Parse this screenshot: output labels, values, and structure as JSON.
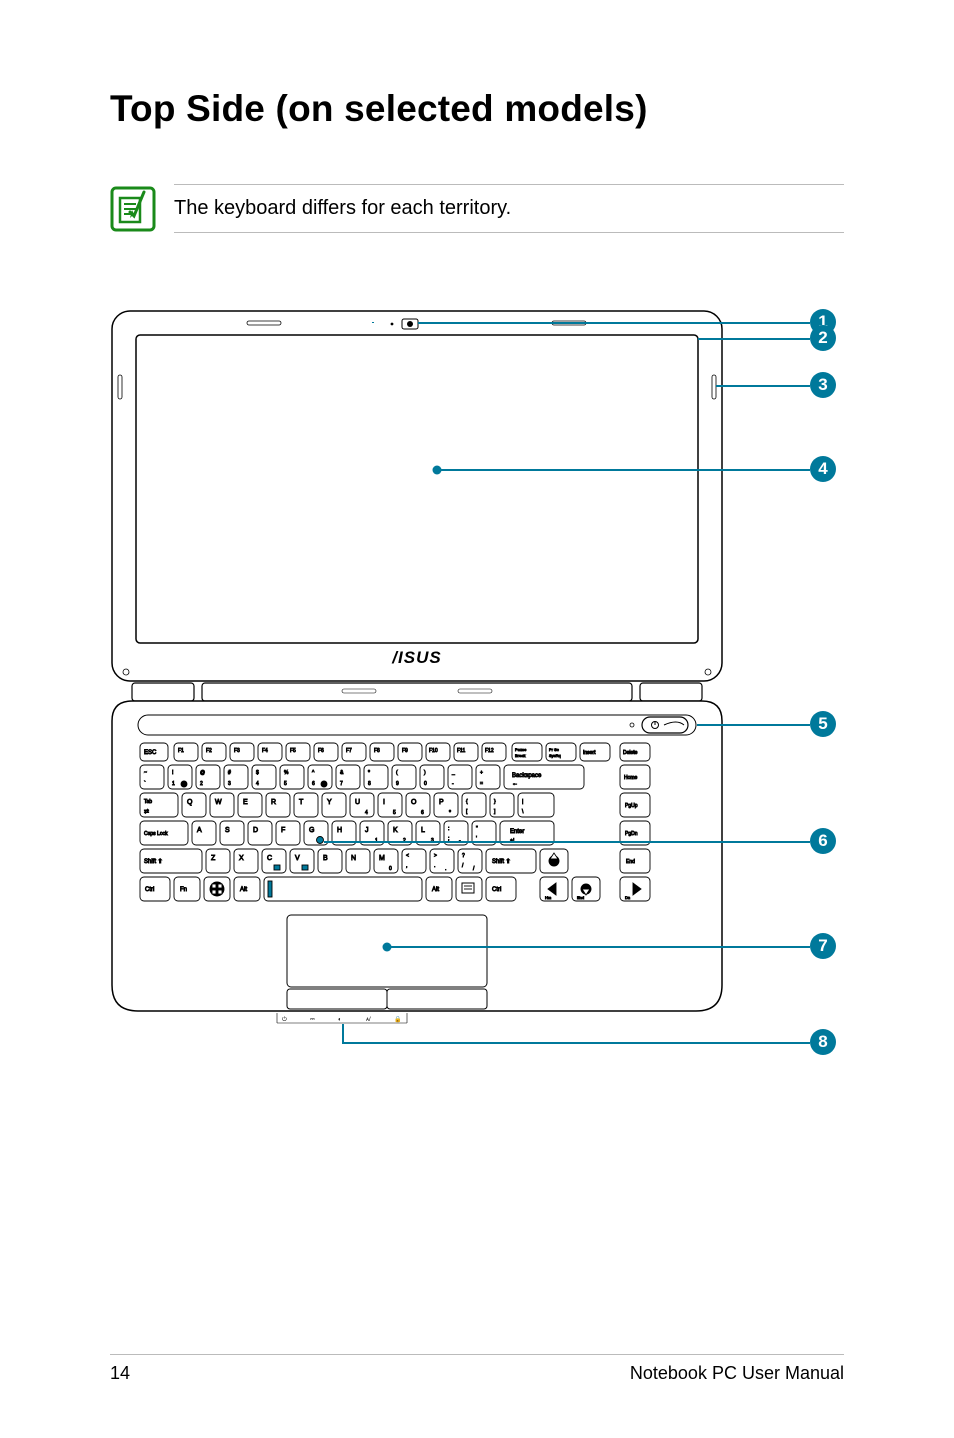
{
  "page": {
    "title": "Top Side (on selected models)",
    "note": "The keyboard differs for each territory.",
    "footer_page": "14",
    "footer_manual": "Notebook PC User Manual"
  },
  "callouts": {
    "c1": "1",
    "c2": "2",
    "c3": "3",
    "c4": "4",
    "c5": "5",
    "c6": "6",
    "c7": "7",
    "c8": "8"
  },
  "diagram": {
    "brand": "ASUS",
    "keys": {
      "esc": "ESC",
      "row_f": [
        "F1",
        "F2",
        "F3",
        "F4",
        "F5",
        "F6",
        "F7",
        "F8",
        "F9",
        "F10",
        "F11",
        "F12",
        "Pause Break",
        "Pr Sc SysRq",
        "Insert",
        "Delete"
      ],
      "row_num_top": [
        "~",
        "!",
        "@",
        "#",
        "$",
        "%",
        "^",
        "&",
        "*",
        "(",
        ")",
        "_",
        "+"
      ],
      "row_num_bottom": [
        "`",
        "1",
        "2",
        "3",
        "4",
        "5",
        "6",
        "7",
        "8",
        "9",
        "0",
        "-",
        "="
      ],
      "backspace": "Backspace",
      "home": "Home",
      "tab": "Tab",
      "row_qwert": [
        "Q",
        "W",
        "E",
        "R",
        "T",
        "Y",
        "U",
        "I",
        "O",
        "P",
        "{",
        "}",
        "|"
      ],
      "row_qwert_sub": [
        "",
        "",
        "",
        "",
        "",
        "",
        "",
        "",
        "",
        "",
        "[",
        "]",
        "\\"
      ],
      "pgup": "PgUp",
      "caps": "Caps Lock",
      "row_asdf": [
        "A",
        "S",
        "D",
        "F",
        "G",
        "H",
        "J",
        "K",
        "L",
        ":",
        "\""
      ],
      "row_asdf_sub": [
        "",
        "",
        "",
        "",
        "",
        "",
        "",
        "",
        "",
        ";",
        "'"
      ],
      "enter": "Enter",
      "pgdn": "PgDn",
      "shift_l": "Shift",
      "row_zxcv": [
        "Z",
        "X",
        "C",
        "V",
        "B",
        "N",
        "M",
        "<",
        ">",
        "?"
      ],
      "row_zxcv_sub": [
        "",
        "",
        "",
        "",
        "",
        "",
        "",
        ",",
        ".",
        "/"
      ],
      "shift_r": "Shift",
      "up": "▲",
      "end": "End",
      "ctrl_l": "Ctrl",
      "fn": "Fn",
      "win": "win",
      "alt_l": "Alt",
      "space": "",
      "alt_r": "Alt",
      "menu": "menu",
      "ctrl_r": "Ctrl",
      "left": "◄",
      "down": "▼",
      "right": "►"
    }
  }
}
